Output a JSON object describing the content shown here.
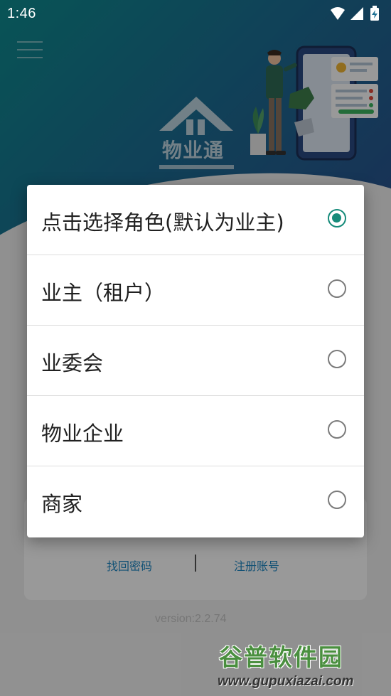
{
  "status_bar": {
    "time": "1:46",
    "icons": [
      "wifi-icon",
      "cellular-signal-icon",
      "battery-charging-icon"
    ]
  },
  "header": {
    "menu_icon": "hamburger-menu-icon",
    "logo_text": "物业通",
    "illustration": "person-with-phone-illustration"
  },
  "login": {
    "find_password": "找回密码",
    "register": "注册账号",
    "version": "version:2.2.74"
  },
  "dialog": {
    "options": [
      {
        "label": "点击选择角色(默认为业主)",
        "checked": true
      },
      {
        "label": "业主（租户）",
        "checked": false
      },
      {
        "label": "业委会",
        "checked": false
      },
      {
        "label": "物业企业",
        "checked": false
      },
      {
        "label": "商家",
        "checked": false
      }
    ]
  },
  "watermark": {
    "title": "谷普软件园",
    "url": "www.gupuxiazai.com"
  },
  "colors": {
    "accent": "#168b7a",
    "link": "#1e88c4",
    "header_gradient_start": "#0e8c8f",
    "header_gradient_end": "#2b4f8f"
  }
}
